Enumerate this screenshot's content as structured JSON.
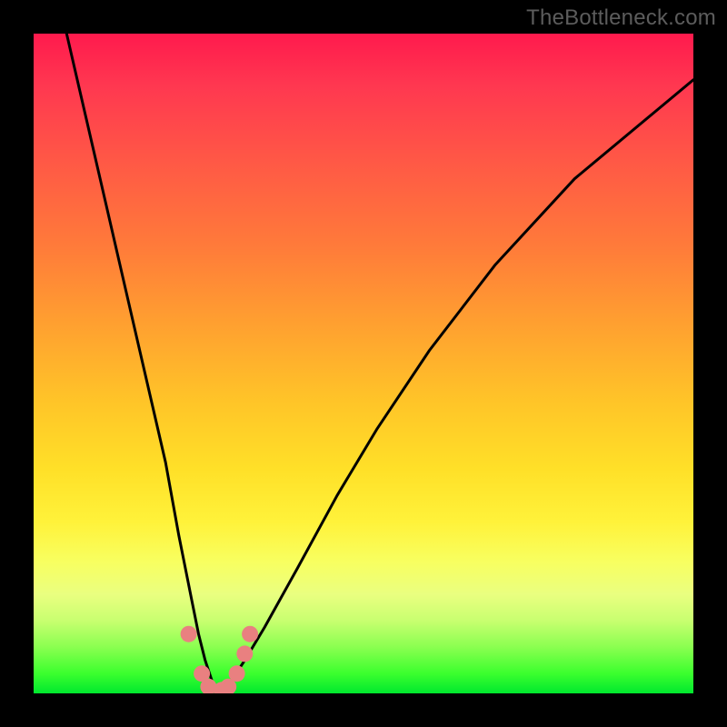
{
  "watermark": "TheBottleneck.com",
  "colors": {
    "gradient_top": "#ff1a4d",
    "gradient_mid": "#ffc528",
    "gradient_bottom": "#00e82e",
    "curve": "#000000",
    "dots": "#e98080",
    "background": "#000000"
  },
  "chart_data": {
    "type": "line",
    "title": "",
    "xlabel": "",
    "ylabel": "",
    "xlim": [
      0,
      100
    ],
    "ylim": [
      0,
      100
    ],
    "grid": false,
    "legend": false,
    "series": [
      {
        "name": "bottleneck-curve",
        "x": [
          5,
          8,
          11,
          14,
          17,
          20,
          22,
          24,
          25,
          26,
          27,
          28,
          29,
          30,
          32,
          35,
          40,
          46,
          52,
          60,
          70,
          82,
          94,
          100
        ],
        "y": [
          100,
          87,
          74,
          61,
          48,
          35,
          24,
          14,
          9,
          5,
          2,
          0,
          0,
          2,
          5,
          10,
          19,
          30,
          40,
          52,
          65,
          78,
          88,
          93
        ]
      }
    ],
    "markers": [
      {
        "x": 23.5,
        "y": 9
      },
      {
        "x": 25.5,
        "y": 3
      },
      {
        "x": 26.5,
        "y": 1
      },
      {
        "x": 28.5,
        "y": 0.5
      },
      {
        "x": 29.5,
        "y": 1
      },
      {
        "x": 30.8,
        "y": 3
      },
      {
        "x": 32.0,
        "y": 6
      },
      {
        "x": 32.8,
        "y": 9
      }
    ]
  }
}
